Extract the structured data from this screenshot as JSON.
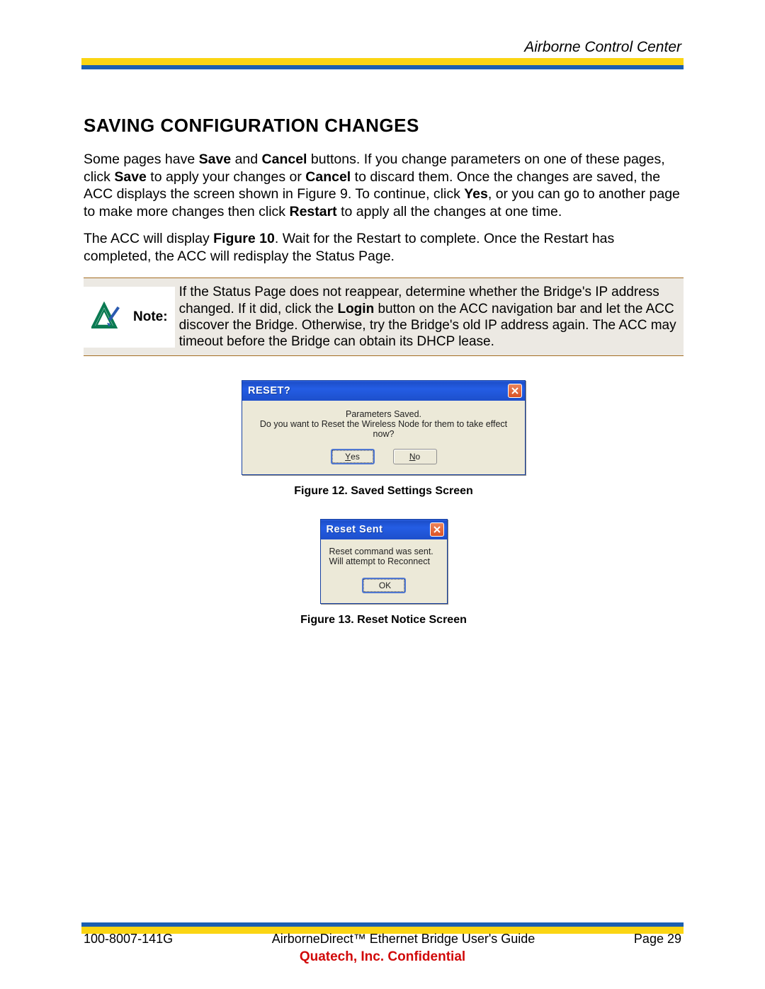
{
  "header": {
    "title": "Airborne Control Center"
  },
  "heading": "SAVING CONFIGURATION CHANGES",
  "para1": {
    "t1": "Some pages have ",
    "b1": "Save",
    "t2": " and ",
    "b2": "Cancel",
    "t3": " buttons. If you change parameters on one of these pages, click ",
    "b3": "Save",
    "t4": " to apply your changes or ",
    "b4": "Cancel",
    "t5": " to discard them. Once the changes are saved, the ACC displays the screen shown in Figure 9. To continue, click ",
    "b5": "Yes",
    "t6": ", or you can go to another page to make more changes then click ",
    "b6": "Restart",
    "t7": " to apply all the changes at one time."
  },
  "para2": {
    "t1": "The ACC will display ",
    "b1": "Figure 10",
    "t2": ".  Wait for the Restart to complete. Once the Restart has completed, the ACC will redisplay the Status Page."
  },
  "note": {
    "label": "Note:",
    "body_t1": "If the Status Page does not reappear, determine whether the Bridge's IP address changed. If it did, click the ",
    "body_b1": "Login",
    "body_t2": " button on the ACC navigation bar and let the ACC discover the Bridge.  Otherwise, try the Bridge's old IP address again. The ACC may timeout before the Bridge can obtain its DHCP lease."
  },
  "dialog1": {
    "title": "RESET?",
    "line1": "Parameters Saved.",
    "line2": "Do you want to Reset the Wireless Node for them to take effect now?",
    "yes_pre": "Y",
    "yes_rest": "es",
    "no_pre": "N",
    "no_rest": "o"
  },
  "caption1": "Figure 12.  Saved Settings Screen",
  "dialog2": {
    "title": "Reset Sent",
    "line1": "Reset command was sent.",
    "line2": "Will attempt to Reconnect",
    "ok": "OK"
  },
  "caption2": "Figure 13.  Reset Notice Screen",
  "footer": {
    "doc_number": "100-8007-141G",
    "doc_title": "AirborneDirect™ Ethernet Bridge User's Guide",
    "page": "Page 29",
    "confidential": "Quatech, Inc. Confidential"
  }
}
